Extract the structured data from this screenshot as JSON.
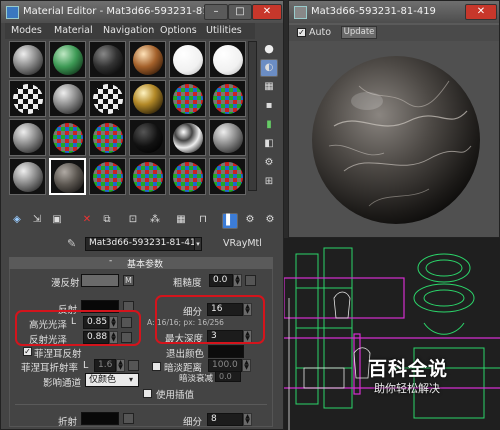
{
  "editor": {
    "title": "Material Editor - Mat3d66-593231-81-419",
    "menu": [
      "Modes",
      "Material",
      "Navigation",
      "Options",
      "Utilities"
    ],
    "material_name": "Mat3d66-593231-81-419",
    "material_type": "VRayMtl",
    "rollout_title": "基本参数",
    "diffuse_label": "漫反射",
    "diffuse_map_btn": "M",
    "roughness_label": "粗糙度",
    "roughness_value": "0.0",
    "reflect_label": "反射",
    "hilight_gloss_label": "高光光泽",
    "hilight_gloss_lock": "L",
    "hilight_gloss_value": "0.85",
    "refl_gloss_label": "反射光泽",
    "refl_gloss_value": "0.88",
    "subdivs_label": "细分",
    "subdivs_value": "16",
    "aa_info": "A: 16/16; px: 16/256",
    "max_depth_label": "最大深度",
    "max_depth_value": "3",
    "fresnel_label": "菲涅耳反射",
    "fresnel_checked": true,
    "fresnel_ior_label": "菲涅耳折射率",
    "fresnel_ior_lock": "L",
    "fresnel_ior_value": "1.6",
    "exit_color_label": "退出颜色",
    "dim_distance_label": "暗淡距离",
    "dim_distance_value": "100.0",
    "dim_falloff_label": "暗淡衰减",
    "dim_falloff_value": "0.0",
    "affect_channels_label": "影响通道",
    "affect_channels_value": "仅颜色",
    "use_interp_label": "使用插值",
    "refract_label": "折射",
    "refract_subdivs_label": "细分",
    "refract_subdivs_value": "8"
  },
  "preview": {
    "title": "Mat3d66-593231-81-419",
    "auto_label": "Auto",
    "auto_checked": true,
    "update_label": "Update"
  },
  "watermark": {
    "title": "百科全说",
    "subtitle": "助你轻松解决"
  },
  "colors": {
    "highlight_box": "#d4141c",
    "viewport_green": "#2bd66a",
    "viewport_magenta": "#d42fd0"
  },
  "slot_icons": [
    "grey-sphere",
    "green-sphere",
    "dark-sphere",
    "copper-sphere",
    "white-sphere",
    "white-sphere",
    "checker-sphere",
    "grey-sphere",
    "checker-sphere",
    "gold-sphere",
    "rgb-checker-sphere",
    "rgb-checker-sphere",
    "grey-sphere",
    "rgb-checker-sphere",
    "rgb-checker-sphere",
    "black-sphere",
    "chrome-sphere",
    "grey-sphere",
    "grey-sphere",
    "marble-sphere",
    "rgb-checker-sphere",
    "rgb-checker-sphere",
    "rgb-checker-sphere",
    "rgb-checker-sphere"
  ]
}
